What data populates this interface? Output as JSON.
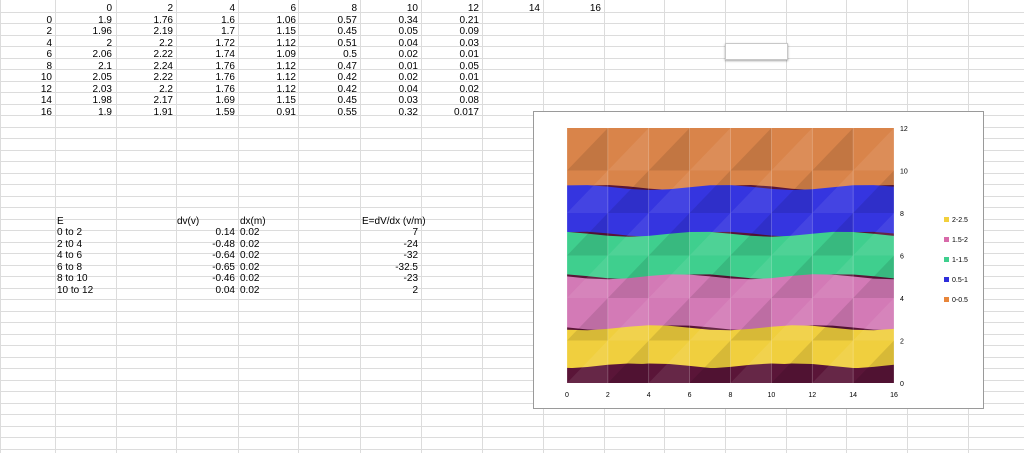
{
  "header_row": {
    "cols": [
      "0",
      "2",
      "4",
      "6",
      "8",
      "10",
      "12",
      "14",
      "16"
    ]
  },
  "table_rows": [
    {
      "label": "0",
      "values": [
        "1.9",
        "1.76",
        "1.6",
        "1.06",
        "0.57",
        "0.34",
        "0.21"
      ]
    },
    {
      "label": "2",
      "values": [
        "1.96",
        "2.19",
        "1.7",
        "1.15",
        "0.45",
        "0.05",
        "0.09"
      ]
    },
    {
      "label": "4",
      "values": [
        "2",
        "2.2",
        "1.72",
        "1.12",
        "0.51",
        "0.04",
        "0.03"
      ]
    },
    {
      "label": "6",
      "values": [
        "2.06",
        "2.22",
        "1.74",
        "1.09",
        "0.5",
        "0.02",
        "0.01"
      ]
    },
    {
      "label": "8",
      "values": [
        "2.1",
        "2.24",
        "1.76",
        "1.12",
        "0.47",
        "0.01",
        "0.05"
      ]
    },
    {
      "label": "10",
      "values": [
        "2.05",
        "2.22",
        "1.76",
        "1.12",
        "0.42",
        "0.02",
        "0.01"
      ]
    },
    {
      "label": "12",
      "values": [
        "2.03",
        "2.2",
        "1.76",
        "1.12",
        "0.42",
        "0.04",
        "0.02"
      ]
    },
    {
      "label": "14",
      "values": [
        "1.98",
        "2.17",
        "1.69",
        "1.15",
        "0.45",
        "0.03",
        "0.08"
      ]
    },
    {
      "label": "16",
      "values": [
        "1.9",
        "1.91",
        "1.59",
        "0.91",
        "0.55",
        "0.32",
        "0.017"
      ]
    }
  ],
  "efield": {
    "headers": {
      "e": "E",
      "dv": "dv(v)",
      "dx": "dx(m)",
      "edvdx": "E=dV/dx (v/m)"
    },
    "rows": [
      {
        "range": "0 to 2",
        "dv": "0.14",
        "dx": "0.02",
        "e": "7"
      },
      {
        "range": "2 t0 4",
        "dv": "-0.48",
        "dx": "0.02",
        "e": "-24"
      },
      {
        "range": "4 to 6",
        "dv": "-0.64",
        "dx": "0.02",
        "e": "-32"
      },
      {
        "range": "6 to 8",
        "dv": "-0.65",
        "dx": "0.02",
        "e": "-32.5"
      },
      {
        "range": "8 to 10",
        "dv": "-0.46",
        "dx": "0.02",
        "e": "-23"
      },
      {
        "range": "10 to 12",
        "dv": "0.04",
        "dx": "0.02",
        "e": "2"
      }
    ]
  },
  "chart_data": {
    "type": "heatmap",
    "x_ticks": [
      "0",
      "2",
      "4",
      "6",
      "8",
      "10",
      "12",
      "14",
      "16"
    ],
    "y_ticks": [
      "0",
      "2",
      "4",
      "6",
      "8",
      "10",
      "12"
    ],
    "xlim": [
      0,
      16
    ],
    "ylim": [
      0,
      12
    ],
    "legend_position": "right",
    "legend": [
      {
        "label": "2-2.5",
        "color": "#f2d03c"
      },
      {
        "label": "1.5-2",
        "color": "#d86aaa"
      },
      {
        "label": "1-1.5",
        "color": "#3fcf8e"
      },
      {
        "label": "0.5-1",
        "color": "#2e2edb"
      },
      {
        "label": "0-0.5",
        "color": "#e8863a"
      }
    ],
    "bands": [
      {
        "range": "0-0.5",
        "y_from": 9.2,
        "y_to": 12,
        "color": "#d9844a",
        "top_color": "#b87040"
      },
      {
        "range": "0.5-1",
        "y_from": 7.0,
        "y_to": 9.2,
        "color": "#3535e0"
      },
      {
        "range": "1-1.5",
        "y_from": 5.0,
        "y_to": 7.0,
        "color": "#3fcf8e"
      },
      {
        "range": "1.5-2",
        "y_from": 2.6,
        "y_to": 5.0,
        "color": "#d37ab6"
      },
      {
        "range": "2-2.5",
        "y_from": 0.8,
        "y_to": 2.6,
        "color": "#f0cf3e"
      },
      {
        "range": "base",
        "y_from": 0,
        "y_to": 0.8,
        "color": "#5a1538"
      }
    ]
  }
}
